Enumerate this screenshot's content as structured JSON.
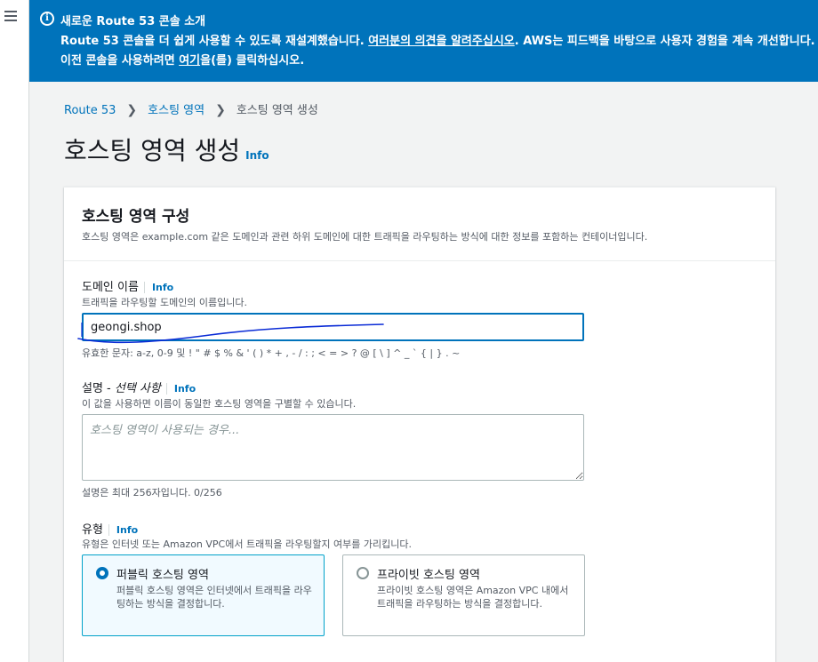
{
  "sidebar": {
    "menu_icon": "hamburger-icon"
  },
  "banner": {
    "icon": "info-circle-icon",
    "title": "새로운 Route 53 콘솔 소개",
    "line1_pre": "Route 53 콘솔을 더 쉽게 사용할 수 있도록 재설계했습니다. ",
    "feedback_link": "여러분의 의견을 알려주십시오",
    "line1_post": ". AWS는 피드백을 바탕으로 사용자 경험을 계속 개선합",
    "line2_pre": "니다. 이전 콘솔을 사용하려면 ",
    "here_link": "여기",
    "line2_post": "을(를) 클릭하십시오."
  },
  "breadcrumb": {
    "items": [
      "Route 53",
      "호스팅 영역",
      "호스팅 영역 생성"
    ]
  },
  "page": {
    "title": "호스팅 영역 생성",
    "info": "Info"
  },
  "card": {
    "title": "호스팅 영역 구성",
    "description": "호스팅 영역은 example.com 같은 도메인과 관련 하위 도메인에 대한 트래픽을 라우팅하는 방식에 대한 정보를 포함하는 컨테이너입니다.",
    "domain": {
      "label": "도메인 이름",
      "info": "Info",
      "hint": "트래픽을 라우팅할 도메인의 이름입니다.",
      "value": "geongi.shop",
      "constraint": "유효한 문자: a-z, 0-9 및 ! \" # $ % & ' ( ) * + , - / : ; < = > ? @ [ \\ ] ^ _ ` { | } . ~"
    },
    "description_field": {
      "label": "설명 - ",
      "label_optional": "선택 사항",
      "info": "Info",
      "hint": "이 값을 사용하면 이름이 동일한 호스팅 영역을 구별할 수 있습니다.",
      "placeholder": "호스팅 영역이 사용되는 경우...",
      "counter": "설명은 최대 256자입니다. 0/256"
    },
    "type": {
      "label": "유형",
      "info": "Info",
      "hint": "유형은 인터넷 또는 Amazon VPC에서 트래픽을 라우팅할지 여부를 가리킵니다.",
      "options": [
        {
          "title": "퍼블릭 호스팅 영역",
          "desc": "퍼블릭 호스팅 영역은 인터넷에서 트래픽을 라우팅하는 방식을 결정합니다.",
          "selected": true
        },
        {
          "title": "프라이빗 호스팅 영역",
          "desc": "프라이빗 호스팅 영역은 Amazon VPC 내에서 트래픽을 라우팅하는 방식을 결정합니다.",
          "selected": false
        }
      ]
    }
  },
  "colors": {
    "banner": "#0073bb",
    "link": "#0073bb",
    "annotation": "#0a2bd6"
  }
}
